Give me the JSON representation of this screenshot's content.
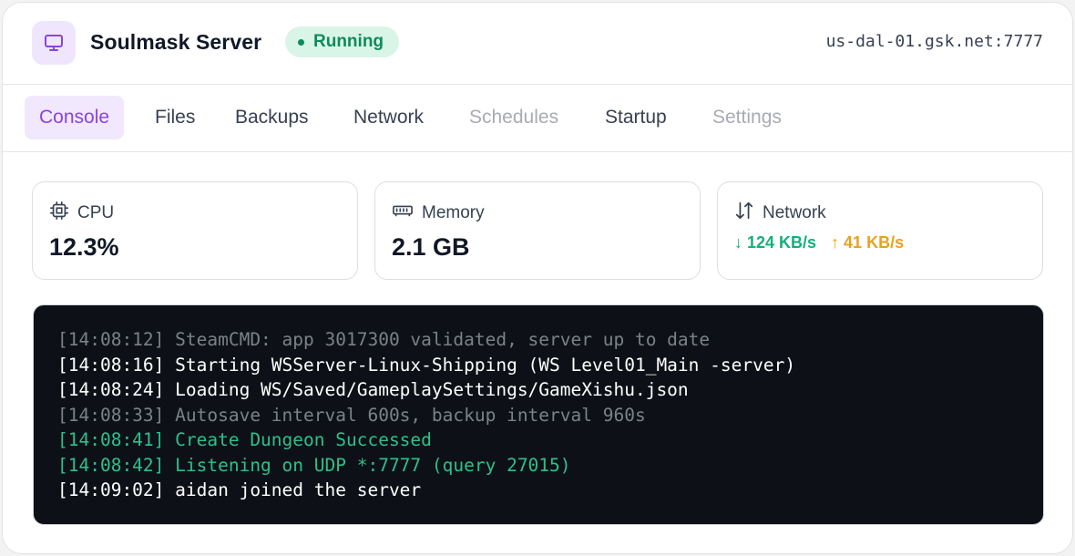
{
  "header": {
    "title": "Soulmask Server",
    "status": "Running",
    "address": "us-dal-01.gsk.net:7777",
    "icon": "monitor-icon",
    "accent": "#8a44e0",
    "status_color": "#0f8a5f"
  },
  "tabs": [
    {
      "label": "Console",
      "state": "active"
    },
    {
      "label": "Files",
      "state": "normal"
    },
    {
      "label": "Backups",
      "state": "normal"
    },
    {
      "label": "Network",
      "state": "normal"
    },
    {
      "label": "Schedules",
      "state": "disabled"
    },
    {
      "label": "Startup",
      "state": "normal"
    },
    {
      "label": "Settings",
      "state": "disabled"
    }
  ],
  "stats": {
    "cpu": {
      "label": "CPU",
      "value": "12.3%",
      "icon": "cpu-icon"
    },
    "memory": {
      "label": "Memory",
      "value": "2.1 GB",
      "icon": "memory-icon"
    },
    "network": {
      "label": "Network",
      "down": "↓ 124 KB/s",
      "up": "↑ 41 KB/s",
      "icon": "transfer-arrows-icon",
      "down_color": "#12b07a",
      "up_color": "#e9a21c"
    }
  },
  "console": {
    "lines": [
      {
        "text": "[14:08:12] SteamCMD: app 3017300 validated, server up to date",
        "style": "dim"
      },
      {
        "text": "[14:08:16] Starting WSServer-Linux-Shipping (WS Level01_Main -server)",
        "style": "normal"
      },
      {
        "text": "[14:08:24] Loading WS/Saved/GameplaySettings/GameXishu.json",
        "style": "normal"
      },
      {
        "text": "[14:08:33] Autosave interval 600s, backup interval 960s",
        "style": "dim"
      },
      {
        "text": "[14:08:41] Create Dungeon Successed",
        "style": "green"
      },
      {
        "text": "[14:08:42] Listening on UDP *:7777 (query 27015)",
        "style": "green"
      },
      {
        "text": "[14:09:02] aidan joined the server",
        "style": "normal"
      }
    ]
  }
}
